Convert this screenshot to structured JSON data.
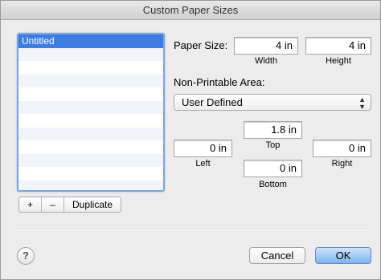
{
  "window": {
    "title": "Custom Paper Sizes"
  },
  "paper_list": {
    "items": [
      "Untitled"
    ],
    "selected_index": 0,
    "buttons": {
      "add": "+",
      "remove": "–",
      "duplicate": "Duplicate"
    }
  },
  "paper_size": {
    "label": "Paper Size:",
    "width": {
      "value": "4 in",
      "label": "Width"
    },
    "height": {
      "value": "4 in",
      "label": "Height"
    }
  },
  "non_printable": {
    "label": "Non-Printable Area:",
    "selected": "User Defined",
    "top": {
      "value": "1.8 in",
      "label": "Top"
    },
    "left": {
      "value": "0 in",
      "label": "Left"
    },
    "right": {
      "value": "0 in",
      "label": "Right"
    },
    "bottom": {
      "value": "0 in",
      "label": "Bottom"
    }
  },
  "footer": {
    "help": "?",
    "cancel": "Cancel",
    "ok": "OK"
  },
  "colors": {
    "accent": "#3d7ce2",
    "default_button": "#7fb4ee"
  }
}
